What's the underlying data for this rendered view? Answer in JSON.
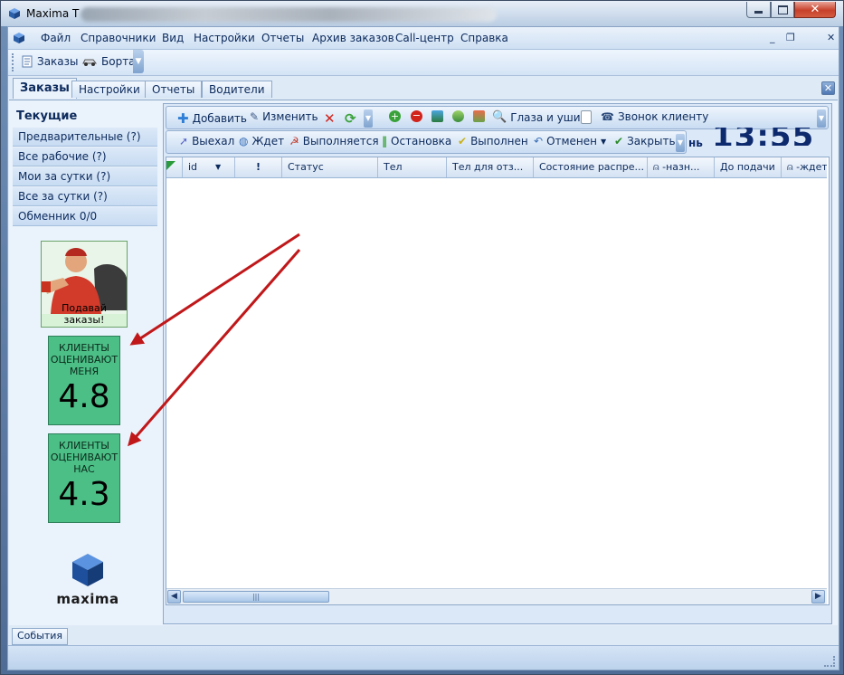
{
  "window": {
    "title": "Maxima T",
    "min_label": "",
    "max_label": "",
    "close_label": ""
  },
  "menu": {
    "items": [
      "Файл",
      "Справочники",
      "Вид",
      "Настройки",
      "Отчеты",
      "Архив заказов",
      "Call-центр",
      "Справка"
    ],
    "mdi": {
      "min": "_",
      "restore": "❐",
      "close": "✕"
    }
  },
  "toolbar": {
    "orders": "Заказы",
    "cars": "Борта"
  },
  "tabs": [
    "Заказы",
    "Настройки",
    "Отчеты",
    "Водители"
  ],
  "sidebar": {
    "header": "Текущие",
    "items": [
      "Предварительные (?)",
      "Все рабочие (?)",
      "Мои за сутки (?)",
      "Все за сутки (?)",
      "Обменник 0/0"
    ]
  },
  "poster": {
    "caption": "Подавай заказы!"
  },
  "ratings": [
    {
      "label_l1": "КЛИЕНТЫ",
      "label_l2": "ОЦЕНИВАЮТ",
      "label_l3": "МЕНЯ",
      "value": "4.8"
    },
    {
      "label_l1": "КЛИЕНТЫ",
      "label_l2": "ОЦЕНИВАЮТ",
      "label_l3": "НАС",
      "value": "4.3"
    }
  ],
  "logo": {
    "text": "maxima"
  },
  "actions": {
    "add": "Добавить",
    "edit": "Изменить",
    "eyes": "Глаза и уши",
    "call_client": "Звонок клиенту",
    "left": "Выехал",
    "wait": "Ждет",
    "in_progress": "Выполняется",
    "stop": "Остановка",
    "done": "Выполнен",
    "cancelled": "Отменен",
    "close": "Закрыть"
  },
  "clock": {
    "prefix": "нь",
    "time": "13:55"
  },
  "grid": {
    "columns": [
      "id",
      "!",
      "Статус",
      "Тел",
      "Тел для отз...",
      "Состояние распре...",
      "-назн...",
      "До подачи",
      "-ждет"
    ]
  },
  "bottom": {
    "events": "События"
  },
  "colors": {
    "rating_bg": "#4cbf87",
    "arrow": "#c0181a",
    "accent": "#0d2a6e"
  }
}
